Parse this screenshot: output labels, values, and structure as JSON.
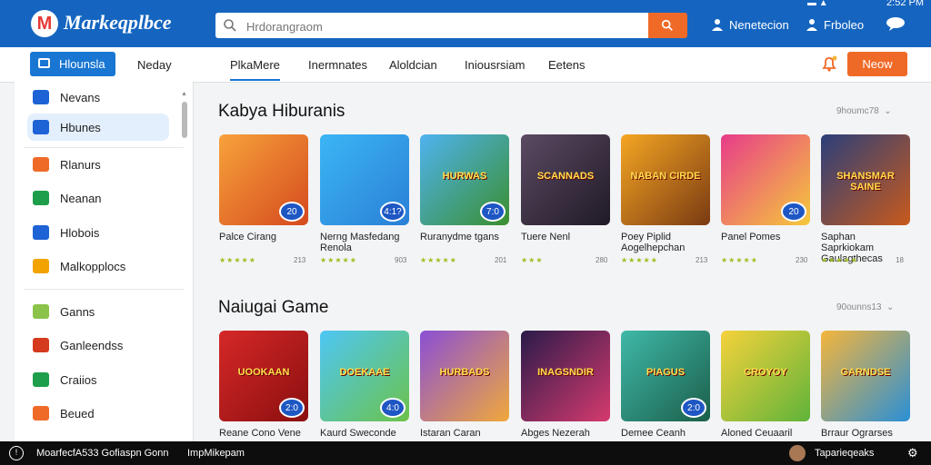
{
  "header": {
    "brand": "Markeqplbce",
    "search_placeholder": "Hrdorangraom",
    "user1": "Nenetecion",
    "user2": "Frboleo",
    "time": "2:52 PM"
  },
  "nav": {
    "home": "Hlounsla",
    "links": [
      "Neday",
      "PlkaMere",
      "Inermnates",
      "Aloldcian",
      "Iniousrsiam",
      "Eetens"
    ],
    "cta": "Neow"
  },
  "sidebar": {
    "items": [
      {
        "label": "Nevans",
        "icon": "document-icon",
        "color": "#1e63d6"
      },
      {
        "label": "Hbunes",
        "icon": "mail-icon",
        "color": "#1e63d6"
      },
      {
        "label": "Rlanurs",
        "icon": "flag-icon",
        "color": "#f06a27"
      },
      {
        "label": "Neanan",
        "icon": "message-icon",
        "color": "#1e9e4a"
      },
      {
        "label": "Hlobois",
        "icon": "refresh-icon",
        "color": "#1e63d6"
      },
      {
        "label": "Malkopplocs",
        "icon": "game-controller-icon",
        "color": "#f2a300"
      },
      {
        "label": "Ganns",
        "icon": "check-icon",
        "color": "#8bc34a"
      },
      {
        "label": "Ganleendss",
        "icon": "square-icon",
        "color": "#d63a1e"
      },
      {
        "label": "Craiios",
        "icon": "code-icon",
        "color": "#1e9e4a"
      },
      {
        "label": "Beued",
        "icon": "box-icon",
        "color": "#f06a27"
      }
    ]
  },
  "sections": [
    {
      "title": "Kabya Hiburanis",
      "meta": "9houmc78",
      "cards": [
        {
          "name": "Palce Cirang",
          "badge": "20",
          "thumb_title": "",
          "rating": "★★★★★",
          "count": "213",
          "bg": "linear-gradient(135deg,#f7a23b,#d54a1e)"
        },
        {
          "name": "Nerng Masfedang Renola",
          "badge": "4:1?",
          "thumb_title": "",
          "rating": "★★★★★",
          "count": "903",
          "bg": "linear-gradient(135deg,#3bb6f5,#2a7fd6)"
        },
        {
          "name": "Ruranydme tgans",
          "badge": "7:0",
          "thumb_title": "HURWAS",
          "rating": "★★★★★",
          "count": "201",
          "bg": "linear-gradient(135deg,#4fb3f0,#3a8f2f)"
        },
        {
          "name": "Tuere Nenl",
          "badge": "",
          "thumb_title": "SCANNADS",
          "rating": "★★★",
          "count": "280",
          "bg": "linear-gradient(135deg,#5b4a63,#201a26)"
        },
        {
          "name": "Poey Piplid Aogelhepchan",
          "badge": "",
          "thumb_title": "NABAN CIRDE",
          "rating": "★★★★★",
          "count": "213",
          "bg": "linear-gradient(135deg,#f5a623,#7a3a12)"
        },
        {
          "name": "Panel Pomes",
          "badge": "20",
          "thumb_title": "",
          "rating": "★★★★★",
          "count": "230",
          "bg": "linear-gradient(135deg,#e83c8a,#f5c93b)"
        },
        {
          "name": "Saphan Saprkiokam Gaulagthecas",
          "badge": "",
          "thumb_title": "SHANSMAR SAINE",
          "rating": "★★★★★",
          "count": "18",
          "bg": "linear-gradient(135deg,#2b3f7a,#c85a1c)"
        }
      ]
    },
    {
      "title": "Naiugai Game",
      "meta": "90ounns13",
      "cards": [
        {
          "name": "Reane Cono Vene",
          "badge": "2:0",
          "thumb_title": "UOOKAAN",
          "rating": "",
          "count": "",
          "bg": "linear-gradient(135deg,#d62828,#8a0f0f)"
        },
        {
          "name": "Kaurd Sweconde",
          "badge": "4:0",
          "thumb_title": "DOEKAAE",
          "rating": "",
          "count": "",
          "bg": "linear-gradient(135deg,#4ec7f5,#6cc24a)"
        },
        {
          "name": "Istaran Caran",
          "badge": "",
          "thumb_title": "HURBADS",
          "rating": "",
          "count": "",
          "bg": "linear-gradient(135deg,#8a4fd6,#f0a83b)"
        },
        {
          "name": "Abges Nezerah",
          "badge": "",
          "thumb_title": "INAGSNDIR",
          "rating": "",
          "count": "",
          "bg": "linear-gradient(135deg,#2a1b4a,#d63a6e)"
        },
        {
          "name": "Demee Ceanh",
          "badge": "2:0",
          "thumb_title": "PIAGUS",
          "rating": "",
          "count": "",
          "bg": "linear-gradient(135deg,#3fb8a8,#1b5f4a)"
        },
        {
          "name": "Aloned Ceuaaril",
          "badge": "",
          "thumb_title": "CROYOY",
          "rating": "",
          "count": "",
          "bg": "linear-gradient(135deg,#f5d23b,#5fb33a)"
        },
        {
          "name": "Brraur Ograrses",
          "badge": "",
          "thumb_title": "GARNDSE",
          "rating": "",
          "count": "",
          "bg": "linear-gradient(135deg,#f5b53b,#2a8fd6)"
        }
      ]
    }
  ],
  "footer": {
    "text1": "MoarfecfA533 Gofiaspn Gonn",
    "text2": "ImpMikepam",
    "user": "Taparieqeaks"
  }
}
